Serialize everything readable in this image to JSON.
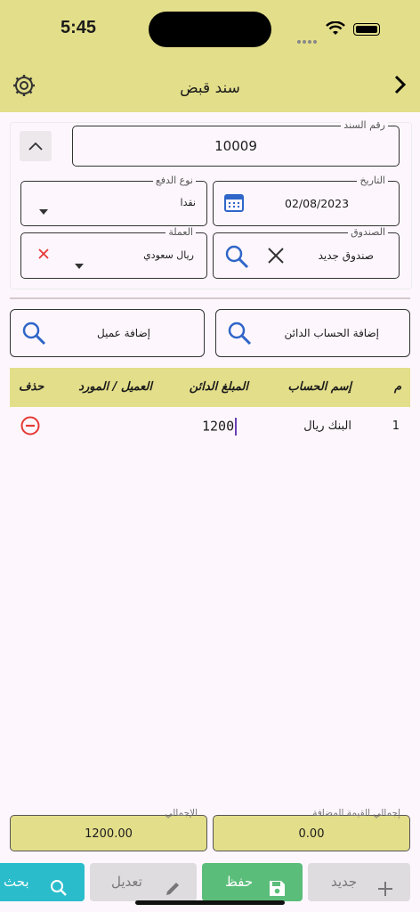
{
  "status": {
    "time": "5:45"
  },
  "appbar": {
    "title": "سند قبض"
  },
  "form": {
    "voucher_number_label": "رقم السند",
    "voucher_number_value": "10009",
    "payment_type_label": "نوع الدفع",
    "payment_type_value": "نقدا",
    "date_label": "التاريخ",
    "date_value": "02/08/2023",
    "currency_label": "العملة",
    "currency_value": "ريال سعودي",
    "box_label": "الصندوق",
    "box_value": "صندوق جديد"
  },
  "actions": {
    "add_creditor_label": "إضافة الحساب الدائن",
    "add_customer_label": "إضافة عميل"
  },
  "table": {
    "headers": {
      "no": "م",
      "account_name": "إسم الحساب",
      "credit_amount": "المبلغ الدائن",
      "customer_supplier": "العميل / المورد",
      "delete": "حذف"
    },
    "rows": [
      {
        "no": "1",
        "account_name": "البنك ريال",
        "credit_amount": "1200",
        "customer_supplier": ""
      }
    ]
  },
  "summary": {
    "vat_total_label": "إجمالي القيمة المضافة",
    "vat_total_value": "0.00",
    "total_label": "الإجمالي",
    "total_value": "1200.00"
  },
  "bottom": {
    "new_label": "جديد",
    "save_label": "حفظ",
    "edit_label": "تعديل",
    "search_label": "بحث"
  },
  "colors": {
    "accent": "#e3de8a",
    "save": "#5bbd7a",
    "search": "#2bbccc",
    "disabled": "#dedcde",
    "icon_blue": "#2f66c8",
    "delete_red": "#e53935"
  }
}
